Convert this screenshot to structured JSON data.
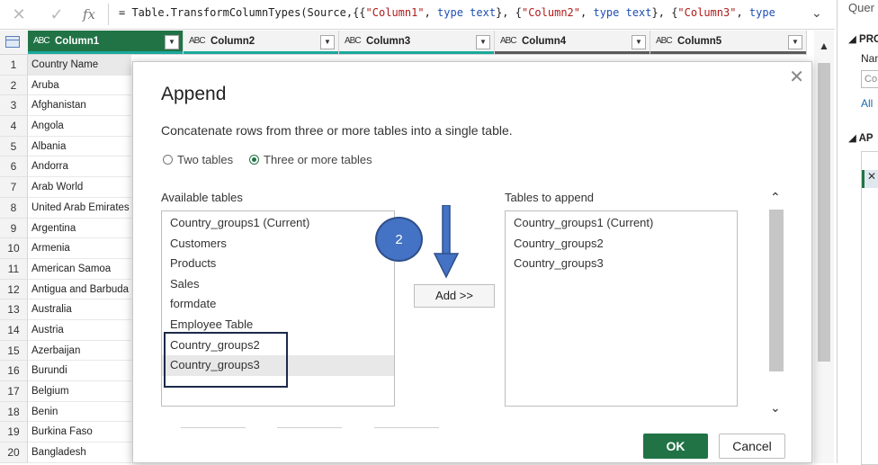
{
  "formula_bar": {
    "cancel_icon": "✕",
    "commit_icon": "✓",
    "fx_label": "fx",
    "formula_parts": [
      {
        "t": "= Table.TransformColumnTypes(Source,{{",
        "c": ""
      },
      {
        "t": "\"Column1\"",
        "c": "str"
      },
      {
        "t": ", ",
        "c": ""
      },
      {
        "t": "type",
        "c": "kw"
      },
      {
        "t": " ",
        "c": ""
      },
      {
        "t": "text",
        "c": "kw"
      },
      {
        "t": "}, {",
        "c": ""
      },
      {
        "t": "\"Column2\"",
        "c": "str"
      },
      {
        "t": ", ",
        "c": ""
      },
      {
        "t": "type",
        "c": "kw"
      },
      {
        "t": " ",
        "c": ""
      },
      {
        "t": "text",
        "c": "kw"
      },
      {
        "t": "}, {",
        "c": ""
      },
      {
        "t": "\"Column3\"",
        "c": "str"
      },
      {
        "t": ", ",
        "c": ""
      },
      {
        "t": "type",
        "c": "kw"
      }
    ],
    "expand_icon": "⌄"
  },
  "grid": {
    "columns": [
      {
        "type_icon": "ABC",
        "name": "Column1",
        "active": true
      },
      {
        "type_icon": "ABC",
        "name": "Column2",
        "active": false
      },
      {
        "type_icon": "ABC",
        "name": "Column3",
        "active": false
      },
      {
        "type_icon": "ABC",
        "name": "Column4",
        "active": false
      },
      {
        "type_icon": "ABC",
        "name": "Column5",
        "active": false
      }
    ],
    "row_numbers": [
      "1",
      "2",
      "3",
      "4",
      "5",
      "6",
      "7",
      "8",
      "9",
      "10",
      "11",
      "12",
      "13",
      "14",
      "15",
      "16",
      "17",
      "18",
      "19",
      "20"
    ],
    "column1_values": [
      "Country Name",
      "Aruba",
      "Afghanistan",
      "Angola",
      "Albania",
      "Andorra",
      "Arab World",
      "United Arab Emirates",
      "Argentina",
      "Armenia",
      "American Samoa",
      "Antigua and Barbuda",
      "Australia",
      "Austria",
      "Azerbaijan",
      "Burundi",
      "Belgium",
      "Benin",
      "Burkina Faso",
      "Bangladesh"
    ]
  },
  "queries_pane": {
    "title": "Quer",
    "properties_heading": "PRO",
    "name_label": "Nam",
    "name_value": "Co",
    "all_properties_link": "All",
    "applied_steps_heading": "AP",
    "step_delete_icon": "✕"
  },
  "dialog": {
    "title": "Append",
    "close_icon": "✕",
    "description": "Concatenate rows from three or more tables into a single table.",
    "radio_two": "Two tables",
    "radio_three": "Three or more tables",
    "available_label": "Available tables",
    "available_tables": [
      "Country_groups1 (Current)",
      "Customers",
      "Products",
      "Sales",
      "formdate",
      "Employee Table",
      "Country_groups2",
      "Country_groups3"
    ],
    "selected_available_index": 7,
    "append_label": "Tables to append",
    "append_tables": [
      "Country_groups1 (Current)",
      "Country_groups2",
      "Country_groups3"
    ],
    "add_button": "Add >>",
    "ok_button": "OK",
    "cancel_button": "Cancel",
    "scroll_up_icon": "⌃",
    "scroll_down_icon": "⌄"
  },
  "annotation": {
    "step_badge": "2"
  },
  "colors": {
    "accent_green": "#217346",
    "badge_blue": "#4472c4",
    "highlight_border": "#1d2a4a"
  }
}
